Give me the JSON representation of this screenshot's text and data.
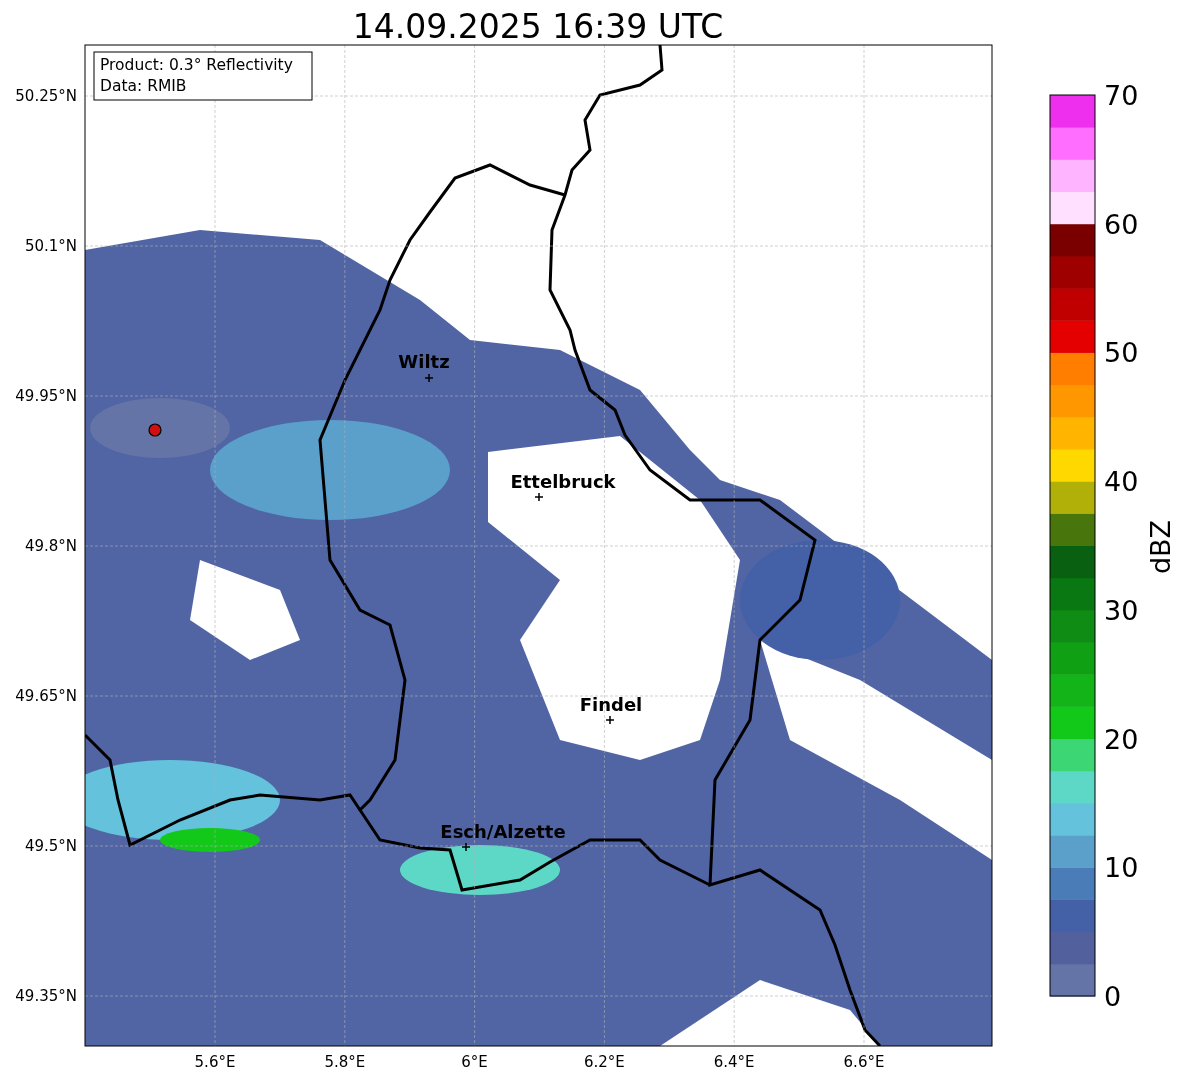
{
  "title": "14.09.2025 16:39 UTC",
  "info": [
    "Product: 0.3° Reflectivity",
    "Data: RMIB"
  ],
  "map": {
    "lat_ticks": [
      "50.25°N",
      "50.1°N",
      "49.95°N",
      "49.8°N",
      "49.65°N",
      "49.5°N",
      "49.35°N"
    ],
    "lon_ticks": [
      "5.6°E",
      "5.8°E",
      "6°E",
      "6.2°E",
      "6.4°E",
      "6.6°E"
    ],
    "cities": [
      {
        "name": "Wiltz"
      },
      {
        "name": "Ettelbruck"
      },
      {
        "name": "Findel"
      },
      {
        "name": "Esch/Alzette"
      }
    ]
  },
  "colorbar": {
    "label": "dBZ",
    "ticks": [
      "70",
      "60",
      "50",
      "40",
      "30",
      "20",
      "10",
      "0"
    ],
    "bands": [
      {
        "color": "#6474a6"
      },
      {
        "color": "#52609e"
      },
      {
        "color": "#4460a6"
      },
      {
        "color": "#4a7db8"
      },
      {
        "color": "#5aa0cb"
      },
      {
        "color": "#64c2dc"
      },
      {
        "color": "#5ed8c6"
      },
      {
        "color": "#3dd674"
      },
      {
        "color": "#12c818"
      },
      {
        "color": "#12b418"
      },
      {
        "color": "#10a014"
      },
      {
        "color": "#0e8c14"
      },
      {
        "color": "#0a7812"
      },
      {
        "color": "#086010"
      },
      {
        "color": "#48760c"
      },
      {
        "color": "#b0b008"
      },
      {
        "color": "#ffd800"
      },
      {
        "color": "#ffb400"
      },
      {
        "color": "#ff9800"
      },
      {
        "color": "#ff7e00"
      },
      {
        "color": "#e40000"
      },
      {
        "color": "#c00000"
      },
      {
        "color": "#9e0000"
      },
      {
        "color": "#7a0000"
      },
      {
        "color": "#ffe0ff"
      },
      {
        "color": "#ffb4ff"
      },
      {
        "color": "#ff6eff"
      },
      {
        "color": "#ee30ee"
      }
    ]
  }
}
